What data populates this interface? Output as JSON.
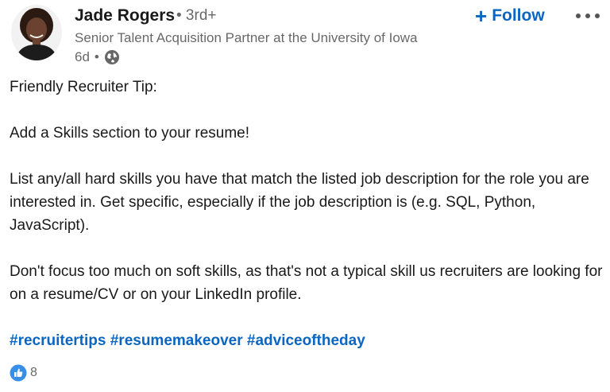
{
  "author": {
    "name": "Jade Rogers",
    "degree": "• 3rd+",
    "headline": "Senior Talent Acquisition Partner at the University of Iowa",
    "time": "6d",
    "visibility_icon": "globe-icon"
  },
  "actions": {
    "follow_label": "Follow",
    "more_icon": "ellipsis-icon"
  },
  "post": {
    "p1": "Friendly Recruiter Tip:",
    "p2": "Add a Skills section to your resume!",
    "p3": "List any/all hard skills you have that match the listed job description for the role you are interested in. Get specific, especially if the job description is (e.g. SQL, Python, JavaScript).",
    "p4": "Don't focus too much on soft skills, as that's not a typical skill us recruiters are looking for on a resume/CV or on your LinkedIn profile.",
    "hashtags": [
      "#recruitertips",
      "#resumemakeover",
      "#adviceoftheday"
    ]
  },
  "social": {
    "reaction_icon": "like-icon",
    "reaction_count": "8"
  },
  "colors": {
    "link_blue": "#0a66c2",
    "like_blue": "#378fe9"
  }
}
